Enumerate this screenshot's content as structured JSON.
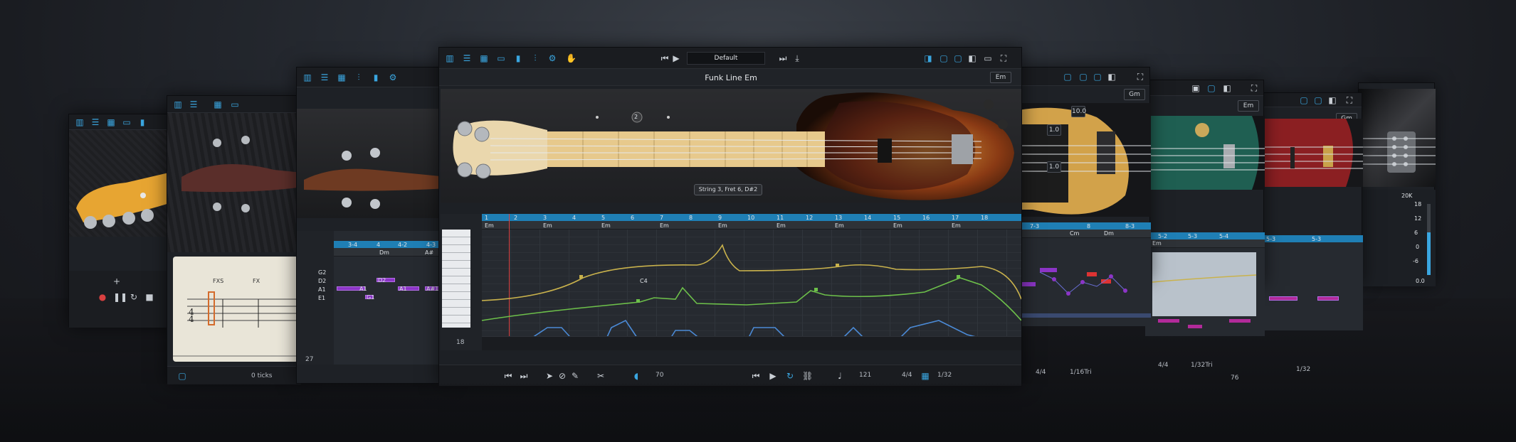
{
  "main": {
    "preset": "Default",
    "patch_title": "Funk Line Em",
    "key": "Em",
    "tooltip": "String 3, Fret 6, D#2",
    "fret_marker": "2",
    "bar_numbers": [
      "1",
      "2",
      "3",
      "4",
      "5",
      "6",
      "7",
      "8",
      "9",
      "10",
      "11",
      "12",
      "13",
      "14",
      "15",
      "16",
      "17",
      "18"
    ],
    "chords": [
      "Em",
      "Em",
      "Em",
      "Em",
      "Em",
      "Em",
      "Em",
      "Em",
      "Em"
    ],
    "velocity_label": "70",
    "tempo": "121",
    "time_sig": "4/4",
    "grid": "1/32",
    "roll_position": "18",
    "left_position": "27",
    "note_tag": "C4"
  },
  "win_a": {
    "ticks": "0 ticks",
    "score_labels": [
      "FXS",
      "FX"
    ]
  },
  "win_b": {
    "chord_ruler": [
      "3-4",
      "4",
      "4-2",
      "4-3"
    ],
    "chord_row": [
      "Dm",
      "A#"
    ],
    "strings": [
      "G2",
      "D2",
      "A1",
      "E1"
    ],
    "notes": [
      "A1",
      "D2",
      "A1",
      "A#1",
      "G1"
    ]
  },
  "win_c": {
    "key": "Gm",
    "values": [
      "10.0",
      "1.0",
      "1.0"
    ],
    "chord_ruler": [
      "7-3",
      "8",
      "8-3"
    ],
    "chord_row": [
      "Cm",
      "Dm"
    ],
    "time_sig": "4/4",
    "grid": "1/16Tri"
  },
  "win_d": {
    "key": "Em",
    "chord_ruler": [
      "5-2",
      "5-3",
      "5-4"
    ],
    "chord_row": [
      "Em"
    ],
    "time_sig": "4/4",
    "grid": "1/32Tri",
    "tempo": "76"
  },
  "win_e": {
    "key": "Gm",
    "chord_ruler": [
      "5-3",
      "5-3"
    ],
    "grid": "1/32"
  },
  "win_f": {
    "level_top": "20K",
    "scale": [
      "18",
      "12",
      "6",
      "0",
      "-6",
      "-12",
      "-18"
    ],
    "readout": "0.0"
  },
  "colors": {
    "accent": "#3aa6e0",
    "ruler": "#1f7fb5",
    "note_purple": "#8c35c7",
    "curve_yellow": "#c9b24c",
    "curve_green": "#6dc04a",
    "curve_blue": "#4b8ad6"
  }
}
